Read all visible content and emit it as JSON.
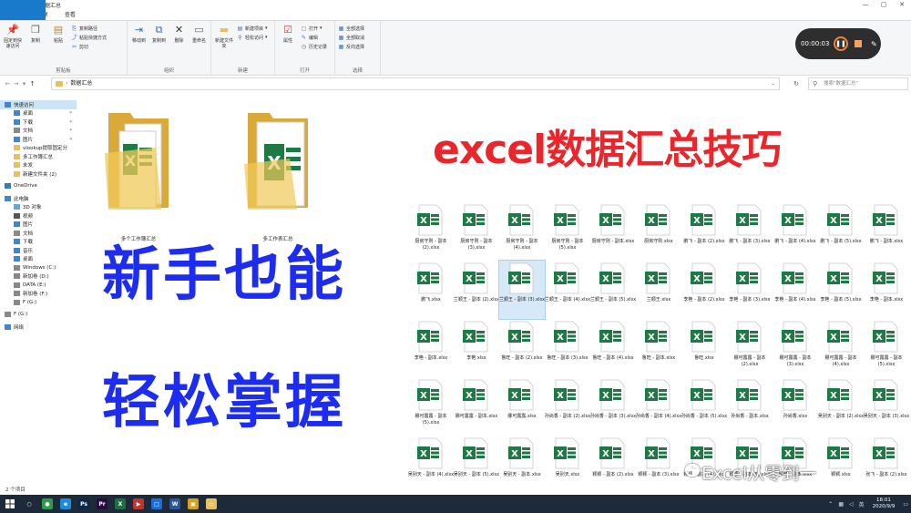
{
  "window": {
    "title": "数据汇总",
    "controls": [
      "—",
      "▢",
      "✕"
    ]
  },
  "ribbon_tabs": [
    {
      "label": "文件",
      "kind": "file"
    },
    {
      "label": "主页",
      "kind": "active"
    },
    {
      "label": "共享",
      "kind": ""
    },
    {
      "label": "查看",
      "kind": ""
    }
  ],
  "ribbon": {
    "clipboard": {
      "label": "剪贴板",
      "pin": "固定到快速访问",
      "copy": "复制",
      "paste": "粘贴",
      "copy_path": "复制路径",
      "paste_shortcut": "粘贴快捷方式",
      "cut": "剪切"
    },
    "organize": {
      "label": "组织",
      "move_to": "移动到",
      "copy_to": "复制到",
      "delete": "删除",
      "rename": "重命名"
    },
    "new": {
      "label": "新建",
      "new_folder": "新建文件夹",
      "new_item": "新建项目",
      "easy_access": "轻松访问"
    },
    "open": {
      "label": "打开",
      "properties": "属性",
      "open": "打开",
      "edit": "编辑",
      "history": "历史记录"
    },
    "select": {
      "label": "选择",
      "select_all": "全部选择",
      "select_none": "全部取消",
      "invert": "反向选择"
    }
  },
  "recorder": {
    "time": "00:00:03"
  },
  "address": {
    "path": "数据汇总",
    "search_placeholder": "搜索\"数据汇总\""
  },
  "nav": [
    {
      "label": "快速访问",
      "level": 1,
      "selected": true,
      "color": "#3b86d9"
    },
    {
      "label": "桌面",
      "level": 2,
      "pin": true,
      "color": "#3b86d9"
    },
    {
      "label": "下载",
      "level": 2,
      "pin": true,
      "color": "#3b86d9"
    },
    {
      "label": "文档",
      "level": 2,
      "pin": true,
      "color": "#8a8a8a"
    },
    {
      "label": "图片",
      "level": 2,
      "pin": true,
      "color": "#3b86d9"
    },
    {
      "label": "vlookup提取固定分",
      "level": 2,
      "color": "#e8c15c"
    },
    {
      "label": "多工作簿汇总",
      "level": 2,
      "color": "#e8c15c"
    },
    {
      "label": "未发",
      "level": 2,
      "color": "#e8c15c"
    },
    {
      "label": "新建文件夹 (2)",
      "level": 2,
      "color": "#e8c15c"
    },
    {
      "gap": true
    },
    {
      "label": "OneDrive",
      "level": 1,
      "color": "#2b7cd3"
    },
    {
      "gap": true
    },
    {
      "label": "此电脑",
      "level": 1,
      "color": "#3b86d9"
    },
    {
      "label": "3D 对象",
      "level": 2,
      "color": "#5fa8e8"
    },
    {
      "label": "视频",
      "level": 2,
      "color": "#555"
    },
    {
      "label": "图片",
      "level": 2,
      "color": "#3b86d9"
    },
    {
      "label": "文档",
      "level": 2,
      "color": "#8a8a8a"
    },
    {
      "label": "下载",
      "level": 2,
      "color": "#3b86d9"
    },
    {
      "label": "音乐",
      "level": 2,
      "color": "#3b86d9"
    },
    {
      "label": "桌面",
      "level": 2,
      "color": "#3b86d9"
    },
    {
      "label": "Windows (C:)",
      "level": 2,
      "color": "#888"
    },
    {
      "label": "新加卷 (D:)",
      "level": 2,
      "color": "#888"
    },
    {
      "label": "DATA (E:)",
      "level": 2,
      "color": "#888"
    },
    {
      "label": "新加卷 (F:)",
      "level": 2,
      "color": "#888"
    },
    {
      "label": "F (G:)",
      "level": 2,
      "color": "#888"
    },
    {
      "gap": true
    },
    {
      "label": "F (G:)",
      "level": 1,
      "color": "#888"
    },
    {
      "gap": true
    },
    {
      "label": "网络",
      "level": 1,
      "color": "#3b86d9"
    }
  ],
  "status": {
    "item_count": "2 个项目"
  },
  "folders": [
    {
      "label": "多个工作簿汇总"
    },
    {
      "label": "多工作表汇总"
    }
  ],
  "overlay": {
    "headline": "excel数据汇总技巧",
    "line1": "新手也能",
    "line2": "轻松掌握",
    "watermark": "Excel从零到一"
  },
  "files": [
    [
      "厨房守则 - 副本 (2).xlsx",
      "厨房守则 - 副本 (3).xlsx",
      "厨房守则 - 副本 (4).xlsx",
      "厨房守则 - 副本 (5).xlsx",
      "厨房守则 - 副本.xlsx",
      "厨房守则.xlsx",
      "鹏飞 - 副本 (2).xlsx",
      "鹏飞 - 副本 (3).xlsx",
      "鹏飞 - 副本 (4).xlsx",
      "鹏飞 - 副本 (5).xlsx",
      "鹏飞 - 副本.xlsx"
    ],
    [
      "鹏飞.xlsx",
      "兰顺王 - 副本 (2).xlsx",
      "兰顺王 - 副本 (3).xlsx",
      "兰顺王 - 副本 (4).xlsx",
      "兰顺王 - 副本 (5).xlsx",
      "兰顺王.xlsx",
      "李艳 - 副本 (2).xlsx",
      "李艳 - 副本 (3).xlsx",
      "李艳 - 副本 (4).xlsx",
      "李艳 - 副本 (5).xlsx",
      "李艳 - 副本.xlsx"
    ],
    [
      "李艳 - 副本.xlsx",
      "李艳.xlsx",
      "鲁旺 - 副本 (2).xlsx",
      "鲁旺 - 副本 (3).xlsx",
      "鲁旺 - 副本 (4).xlsx",
      "鲁旺 - 副本.xlsx",
      "鲁旺.xlsx",
      "娜可露露 - 副本 (2).xlsx",
      "娜可露露 - 副本 (3).xlsx",
      "娜可露露 - 副本 (4).xlsx",
      "娜可露露 - 副本 (5).xlsx"
    ],
    [
      "娜可露露 - 副本 (5).xlsx",
      "娜可露露 - 副本.xlsx",
      "娜可露露.xlsx",
      "孙尚香 - 副本 (2).xlsx",
      "孙尚香 - 副本 (3).xlsx",
      "孙尚香 - 副本 (4).xlsx",
      "孙尚香 - 副本 (5).xlsx",
      "孙尚香 - 副本.xlsx",
      "孙尚香.xlsx",
      "吴别天 - 副本 (2).xlsx",
      "吴别天 - 副本 (3).xlsx"
    ],
    [
      "吴别天 - 副本 (4).xlsx",
      "吴别天 - 副本 (5).xlsx",
      "吴别天 - 副本.xlsx",
      "吴别天.xlsx",
      "颖颖 - 副本 (2).xlsx",
      "颖颖 - 副本 (3).xlsx",
      "颖颖 - 副本 (4).xlsx",
      "颖颖 - 副本 (5).xlsx",
      "颖颖 - 副本.xlsx",
      "颖颖.xlsx",
      "张飞 - 副本 (2).xlsx"
    ]
  ],
  "selected_file": {
    "row": 1,
    "col": 2
  },
  "taskbar": {
    "apps": [
      {
        "name": "search-icon",
        "color": "#1d2a3a",
        "glyph": "○"
      },
      {
        "name": "chrome-icon",
        "color": "#2c9c4a",
        "glyph": "●"
      },
      {
        "name": "edge-icon",
        "color": "#1f8ad6",
        "glyph": "e"
      },
      {
        "name": "photoshop-icon",
        "color": "#0b2a4a",
        "glyph": "Ps"
      },
      {
        "name": "premiere-icon",
        "color": "#2a0b3e",
        "glyph": "Pr"
      },
      {
        "name": "excel-icon",
        "color": "#1d6f42",
        "glyph": "X"
      },
      {
        "name": "media-icon",
        "color": "#c2352a",
        "glyph": "▶"
      },
      {
        "name": "video-editor-icon",
        "color": "#1c6fd1",
        "glyph": "□"
      },
      {
        "name": "word-icon",
        "color": "#2b579a",
        "glyph": "W"
      },
      {
        "name": "image-app-icon",
        "color": "#d6a21c",
        "glyph": "▣"
      },
      {
        "name": "explorer-icon",
        "color": "#e8c15c",
        "glyph": "▭"
      }
    ],
    "tray_language": "英",
    "time": "18:01",
    "date": "2020/9/9"
  }
}
